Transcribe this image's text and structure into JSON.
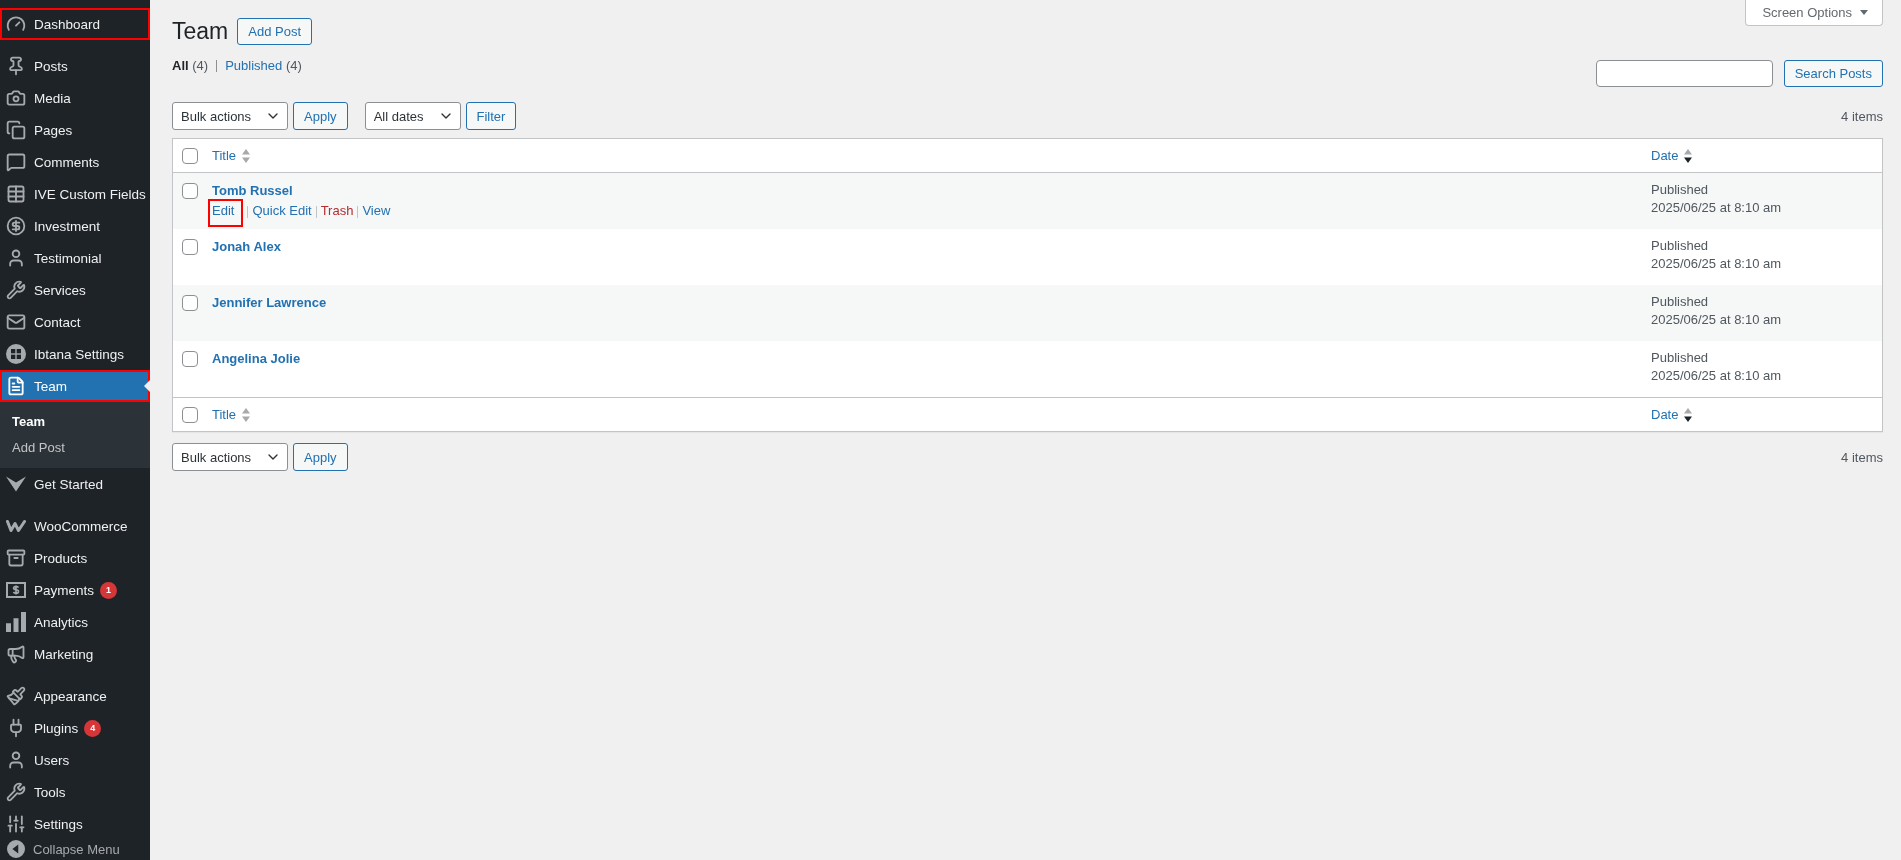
{
  "sidebar": {
    "groups": [
      {
        "items": [
          {
            "label": "Dashboard",
            "selected": false,
            "highlighted": true
          }
        ]
      },
      {
        "items": [
          {
            "label": "Posts",
            "selected": false,
            "highlighted": false
          },
          {
            "label": "Media",
            "selected": false,
            "highlighted": false
          },
          {
            "label": "Pages",
            "selected": false,
            "highlighted": false
          },
          {
            "label": "Comments",
            "selected": false,
            "highlighted": false
          },
          {
            "label": "IVE Custom Fields",
            "selected": false,
            "highlighted": false
          },
          {
            "label": "Investment",
            "selected": false,
            "highlighted": false
          },
          {
            "label": "Testimonial",
            "selected": false,
            "highlighted": false
          },
          {
            "label": "Services",
            "selected": false,
            "highlighted": false
          },
          {
            "label": "Contact",
            "selected": false,
            "highlighted": false
          },
          {
            "label": "Ibtana Settings",
            "selected": false,
            "highlighted": false
          },
          {
            "label": "Team",
            "selected": true,
            "highlighted": true,
            "children": [
              {
                "label": "Team",
                "selected": true
              },
              {
                "label": "Add Post",
                "selected": false
              }
            ]
          },
          {
            "label": "Get Started",
            "selected": false,
            "highlighted": false
          }
        ]
      },
      {
        "items": [
          {
            "label": "WooCommerce",
            "selected": false,
            "highlighted": false
          },
          {
            "label": "Products",
            "selected": false,
            "highlighted": false
          },
          {
            "label": "Payments",
            "selected": false,
            "highlighted": false,
            "badge": "1"
          },
          {
            "label": "Analytics",
            "selected": false,
            "highlighted": false
          },
          {
            "label": "Marketing",
            "selected": false,
            "highlighted": false
          }
        ]
      },
      {
        "items": [
          {
            "label": "Appearance",
            "selected": false,
            "highlighted": false
          },
          {
            "label": "Plugins",
            "selected": false,
            "highlighted": false,
            "badge": "4"
          },
          {
            "label": "Users",
            "selected": false,
            "highlighted": false
          },
          {
            "label": "Tools",
            "selected": false,
            "highlighted": false
          },
          {
            "label": "Settings",
            "selected": false,
            "highlighted": false
          }
        ]
      }
    ],
    "collapse": {
      "label": "Collapse Menu"
    }
  },
  "screen_options": {
    "label": "Screen Options"
  },
  "page": {
    "title": "Team",
    "add_button": "Add Post"
  },
  "views": [
    {
      "label": "All",
      "count": "(4)",
      "selected": true
    },
    {
      "label": "Published",
      "count": "(4)",
      "selected": false
    }
  ],
  "search": {
    "button": "Search Posts"
  },
  "top_toolbar": {
    "groups": [
      {
        "controls": [
          {
            "kind": "select",
            "label": "Bulk actions"
          },
          {
            "kind": "button",
            "label": "Apply"
          }
        ]
      },
      {
        "controls": [
          {
            "kind": "select",
            "label": "All dates"
          },
          {
            "kind": "button",
            "label": "Filter"
          }
        ]
      }
    ],
    "count": "4 items"
  },
  "table": {
    "select_all": {
      "checked": false
    },
    "columns": [
      {
        "label": "Title",
        "sorted": false
      },
      {
        "label": "Date",
        "sorted": true
      }
    ],
    "rows": [
      {
        "checked": false,
        "title": "Tomb Russel",
        "actions": [
          {
            "kind": "link",
            "label": "Edit",
            "highlighted": true
          },
          {
            "kind": "link",
            "label": "Quick Edit",
            "highlighted": false
          },
          {
            "kind": "delete",
            "label": "Trash",
            "highlighted": false
          },
          {
            "kind": "link",
            "label": "View",
            "highlighted": false
          }
        ],
        "status": "Published",
        "date": "2025/06/25 at 8:10 am"
      },
      {
        "checked": false,
        "title": "Jonah Alex",
        "status": "Published",
        "date": "2025/06/25 at 8:10 am"
      },
      {
        "checked": false,
        "title": "Jennifer Lawrence",
        "status": "Published",
        "date": "2025/06/25 at 8:10 am"
      },
      {
        "checked": false,
        "title": "Angelina Jolie",
        "status": "Published",
        "date": "2025/06/25 at 8:10 am"
      }
    ],
    "footer": {
      "select_all": {
        "checked": false
      },
      "columns": [
        {
          "label": "Title",
          "sorted": false
        },
        {
          "label": "Date",
          "sorted": true
        }
      ]
    }
  },
  "bottom_toolbar": {
    "groups": [
      {
        "controls": [
          {
            "kind": "select",
            "label": "Bulk actions"
          },
          {
            "kind": "button",
            "label": "Apply"
          }
        ]
      }
    ],
    "count": "4 items"
  }
}
